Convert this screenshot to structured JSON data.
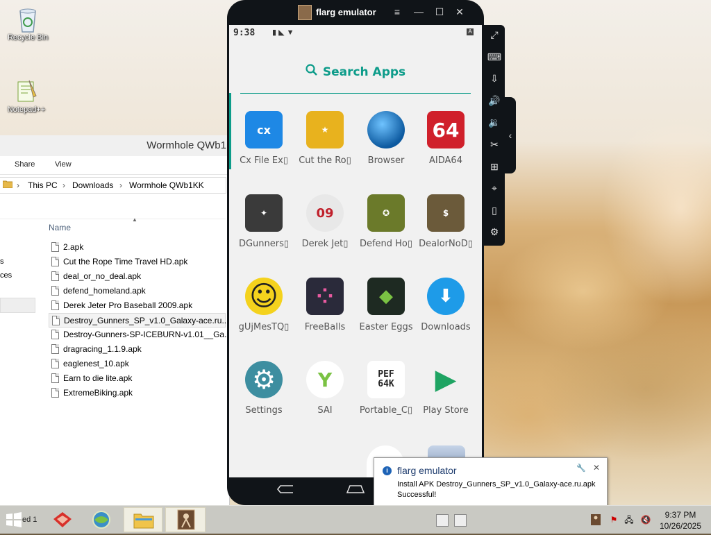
{
  "desktop": {
    "icons": [
      {
        "label": "Recycle Bin"
      },
      {
        "label": "Notepad++"
      }
    ]
  },
  "explorer": {
    "title": "Wormhole QWb1",
    "ribbon": {
      "share": "Share",
      "view": "View"
    },
    "breadcrumb": [
      "This PC",
      "Downloads",
      "Wormhole QWb1KK"
    ],
    "column_header": "Name",
    "nav_partial": [
      "s",
      "ces"
    ],
    "files": [
      "2.apk",
      "Cut the Rope Time Travel HD.apk",
      "deal_or_no_deal.apk",
      "defend_homeland.apk",
      "Derek Jeter Pro Baseball 2009.apk",
      "Destroy_Gunners_SP_v1.0_Galaxy-ace.ru....",
      "Destroy-Gunners-SP-ICEBURN-v1.01__Ga...",
      "dragracing_1.1.9.apk",
      "eaglenest_10.apk",
      "Earn to die lite.apk",
      "ExtremeBiking.apk"
    ]
  },
  "emulator": {
    "title": "flarg emulator",
    "controls": {
      "menu": "≡",
      "minimize": "—",
      "maximize": "☐",
      "close": "✕"
    },
    "status": {
      "time": "9:38",
      "icons": "▮ ◣ ▼",
      "badge": "A"
    },
    "search_label": "Search Apps",
    "apps": [
      {
        "label": "Cx File Ex▯",
        "icon": "cx-file-explorer-icon",
        "glyph": "cx",
        "color": "#1e88e5"
      },
      {
        "label": "Cut the Ro▯",
        "icon": "cut-the-rope-icon",
        "glyph": "★",
        "color": "#e8b21e"
      },
      {
        "label": "Browser",
        "icon": "globe-icon",
        "glyph": "",
        "color": "#1b7ec7"
      },
      {
        "label": "AIDA64",
        "icon": "aida64-icon",
        "glyph": "64",
        "color": "#d0202b"
      },
      {
        "label": "DGunners▯",
        "icon": "destroy-gunners-icon",
        "glyph": "✦",
        "color": "#3a3a3a"
      },
      {
        "label": "Derek Jet▯",
        "icon": "baseball-icon",
        "glyph": "09",
        "color": "#e8e8e8"
      },
      {
        "label": "Defend Ho▯",
        "icon": "defend-homeland-icon",
        "glyph": "✪",
        "color": "#6b7a2a"
      },
      {
        "label": "DealorNoD▯",
        "icon": "deal-or-no-deal-icon",
        "glyph": "$",
        "color": "#6b5a3a"
      },
      {
        "label": "gUjMesTQ▯",
        "icon": "smiley-icon",
        "glyph": "☺",
        "color": "#f4d21d"
      },
      {
        "label": "FreeBalls",
        "icon": "freeballs-icon",
        "glyph": "⁘",
        "color": "#2a2a3a"
      },
      {
        "label": "Easter Eggs",
        "icon": "easter-eggs-icon",
        "glyph": "◆",
        "color": "#1e2a22"
      },
      {
        "label": "Downloads",
        "icon": "download-icon",
        "glyph": "⬇",
        "color": "#1e9be8"
      },
      {
        "label": "Settings",
        "icon": "gear-icon",
        "glyph": "⚙",
        "color": "#3d8ea0"
      },
      {
        "label": "SAI",
        "icon": "sai-icon",
        "glyph": "Y",
        "color": "#ffffff"
      },
      {
        "label": "Portable_C▯",
        "icon": "portable-c-icon",
        "glyph": "PEF 64K",
        "color": "#ffffff"
      },
      {
        "label": "Play Store",
        "icon": "play-store-icon",
        "glyph": "▶",
        "color": "#f1f1f1"
      }
    ],
    "navbar": {
      "back": "⤺",
      "home": "⌂",
      "recents": "▢"
    }
  },
  "sidebar_buttons": [
    {
      "name": "fullscreen-icon",
      "glyph": "⤢"
    },
    {
      "name": "keyboard-icon",
      "glyph": "⌨"
    },
    {
      "name": "install-apk-icon",
      "glyph": "⇩"
    },
    {
      "name": "volume-up-icon",
      "glyph": "🔊"
    },
    {
      "name": "volume-down-icon",
      "glyph": "🔉"
    },
    {
      "name": "screenshot-cut-icon",
      "glyph": "✂"
    },
    {
      "name": "add-window-icon",
      "glyph": "⊞"
    },
    {
      "name": "location-pin-icon",
      "glyph": "⌖"
    },
    {
      "name": "shake-icon",
      "glyph": "▯"
    },
    {
      "name": "settings-gear-icon",
      "glyph": "⚙"
    }
  ],
  "side_tab_glyph": "‹",
  "notification": {
    "title": "flarg emulator",
    "line1": "Install APK Destroy_Gunners_SP_v1.0_Galaxy-ace.ru.apk",
    "line2": "Successful!"
  },
  "taskbar": {
    "partial_text": "ed 1",
    "time": "9:37 PM",
    "date": "10/26/2025"
  },
  "colors": {
    "accent": "#0d9c8a",
    "emulator_frame": "#101418",
    "taskbar": "#c9c9c3"
  }
}
